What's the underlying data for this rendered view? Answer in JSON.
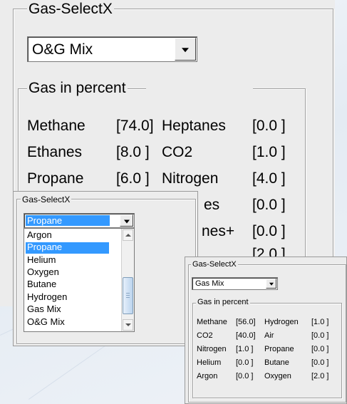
{
  "window_a": {
    "group_title": "Gas-SelectX",
    "selected_gas": "O&G Mix",
    "subgroup_title": "Gas in percent",
    "rows": [
      {
        "name1": "Methane",
        "value1": "[74.0]",
        "name2": "Heptanes",
        "value2": "[0.0 ]"
      },
      {
        "name1": "Ethanes",
        "value1": "[8.0 ]",
        "name2": "CO2",
        "value2": "[1.0 ]"
      },
      {
        "name1": "Propane",
        "value1": "[6.0 ]",
        "name2": "Nitrogen",
        "value2": "[4.0 ]"
      },
      {
        "name2": "es",
        "value2": "[0.0 ]"
      },
      {
        "name2": "nes+",
        "value2": "[0.0 ]"
      },
      {
        "value2": "[2.0 ]"
      }
    ]
  },
  "window_b": {
    "group_title": "Gas-SelectX",
    "selected_gas": "Propane",
    "options": [
      "Argon",
      "Propane",
      "Helium",
      "Oxygen",
      "Butane",
      "Hydrogen",
      "Gas Mix",
      "O&G Mix"
    ],
    "highlighted_option": "Propane"
  },
  "window_c": {
    "group_title": "Gas-SelectX",
    "selected_gas": "Gas Mix",
    "subgroup_title": "Gas in percent",
    "rows": [
      {
        "name1": "Methane",
        "value1": "[56.0]",
        "name2": "Hydrogen",
        "value2": "[1.0 ]"
      },
      {
        "name1": "CO2",
        "value1": "[40.0]",
        "name2": "Air",
        "value2": "[0.0 ]"
      },
      {
        "name1": "Nitrogen",
        "value1": "[1.0 ]",
        "name2": "Propane",
        "value2": "[0.0 ]"
      },
      {
        "name1": "Helium",
        "value1": "[0.0 ]",
        "name2": "Butane",
        "value2": "[0.0 ]"
      },
      {
        "name1": "Argon",
        "value1": "[0.0 ]",
        "name2": "Oxygen",
        "value2": "[2.0 ]"
      }
    ]
  },
  "colors": {
    "panel_bg": "#ececec",
    "selection": "#3399ff",
    "border": "#9a9a9a"
  }
}
